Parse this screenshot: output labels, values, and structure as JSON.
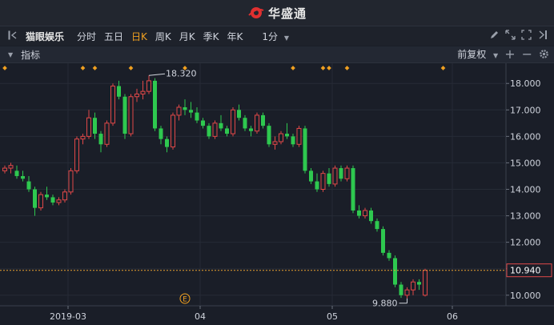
{
  "app": {
    "title": "华盛通"
  },
  "toolbar": {
    "stock_name": "猫眼娱乐",
    "tabs": [
      "分时",
      "五日",
      "日K",
      "周K",
      "月K",
      "季K",
      "年K"
    ],
    "active_tab": "日K",
    "interval": "1分"
  },
  "indicator_bar": {
    "label": "指标",
    "adjust": "前复权"
  },
  "colors": {
    "up": "#e04848",
    "down": "#2ec84f",
    "accent": "#f0a020",
    "bg": "#1a1e28"
  },
  "icons": [
    "logo-icon",
    "sidebar-toggle-icon",
    "dropdown-icon",
    "pencil-icon",
    "expand-icon",
    "fullscreen-icon",
    "collapse-icon",
    "plus-icon",
    "minus-icon",
    "gear-icon"
  ],
  "chart_data": {
    "type": "candlestick",
    "x_ticks": [
      {
        "label": "2019-03",
        "index": 10
      },
      {
        "label": "04",
        "index": 32
      },
      {
        "label": "05",
        "index": 54
      },
      {
        "label": "06",
        "index": 74
      }
    ],
    "y_ticks": [
      "18.000",
      "17.000",
      "16.000",
      "15.000",
      "14.000",
      "13.000",
      "12.000",
      "11.000",
      "10.000"
    ],
    "ylim": [
      9.6,
      18.4
    ],
    "annotations": {
      "high": "18.320",
      "low": "9.880",
      "last_price": "10.940",
      "event_marker": "E"
    },
    "candles": [
      [
        14.7,
        14.9,
        14.6,
        14.8
      ],
      [
        14.8,
        15.0,
        14.6,
        14.9
      ],
      [
        14.7,
        14.9,
        14.4,
        14.5
      ],
      [
        14.5,
        14.7,
        14.3,
        14.4
      ],
      [
        14.3,
        14.5,
        13.9,
        14.0
      ],
      [
        14.0,
        14.1,
        13.0,
        13.3
      ],
      [
        13.3,
        13.9,
        13.2,
        13.8
      ],
      [
        13.8,
        14.1,
        13.6,
        13.7
      ],
      [
        13.7,
        13.8,
        13.4,
        13.5
      ],
      [
        13.5,
        13.7,
        13.4,
        13.6
      ],
      [
        13.6,
        14.0,
        13.5,
        13.9
      ],
      [
        13.9,
        14.8,
        13.8,
        14.7
      ],
      [
        14.7,
        16.0,
        14.6,
        15.9
      ],
      [
        15.9,
        16.1,
        15.7,
        16.0
      ],
      [
        16.0,
        17.0,
        15.9,
        16.7
      ],
      [
        16.7,
        16.9,
        15.9,
        16.1
      ],
      [
        16.1,
        16.2,
        15.4,
        15.7
      ],
      [
        15.7,
        16.6,
        15.6,
        16.5
      ],
      [
        16.5,
        18.0,
        16.4,
        17.9
      ],
      [
        17.9,
        18.1,
        17.4,
        17.5
      ],
      [
        17.5,
        17.6,
        15.9,
        16.1
      ],
      [
        16.1,
        17.6,
        16.0,
        17.5
      ],
      [
        17.5,
        17.8,
        17.3,
        17.6
      ],
      [
        17.6,
        18.1,
        17.4,
        17.7
      ],
      [
        17.7,
        18.3,
        17.6,
        18.1
      ],
      [
        18.1,
        18.2,
        16.2,
        16.3
      ],
      [
        16.3,
        16.4,
        15.7,
        15.9
      ],
      [
        15.9,
        16.0,
        15.4,
        15.6
      ],
      [
        15.6,
        16.9,
        15.5,
        16.8
      ],
      [
        16.8,
        17.2,
        16.6,
        17.1
      ],
      [
        17.1,
        17.4,
        16.8,
        17.0
      ],
      [
        17.0,
        17.3,
        16.7,
        16.9
      ],
      [
        16.9,
        17.1,
        16.5,
        16.6
      ],
      [
        16.6,
        16.7,
        16.3,
        16.4
      ],
      [
        16.4,
        16.5,
        15.9,
        16.0
      ],
      [
        16.0,
        16.6,
        15.9,
        16.5
      ],
      [
        16.5,
        16.8,
        16.2,
        16.3
      ],
      [
        16.3,
        16.4,
        16.0,
        16.1
      ],
      [
        16.1,
        17.1,
        16.0,
        17.0
      ],
      [
        17.0,
        17.2,
        16.6,
        16.7
      ],
      [
        16.7,
        16.8,
        16.2,
        16.3
      ],
      [
        16.3,
        16.4,
        16.0,
        16.2
      ],
      [
        16.2,
        16.9,
        16.1,
        16.8
      ],
      [
        16.8,
        16.9,
        16.3,
        16.4
      ],
      [
        16.4,
        16.5,
        15.6,
        15.7
      ],
      [
        15.7,
        16.0,
        15.5,
        15.8
      ],
      [
        15.8,
        16.2,
        15.7,
        16.1
      ],
      [
        16.1,
        16.5,
        15.9,
        16.0
      ],
      [
        16.0,
        16.1,
        15.6,
        15.7
      ],
      [
        15.7,
        16.4,
        15.6,
        16.3
      ],
      [
        16.3,
        16.4,
        14.6,
        14.7
      ],
      [
        14.7,
        14.8,
        14.2,
        14.3
      ],
      [
        14.3,
        14.6,
        13.9,
        14.0
      ],
      [
        14.0,
        14.7,
        13.9,
        14.6
      ],
      [
        14.6,
        14.8,
        14.1,
        14.2
      ],
      [
        14.2,
        14.9,
        14.1,
        14.8
      ],
      [
        14.8,
        14.9,
        14.3,
        14.4
      ],
      [
        14.4,
        14.9,
        14.3,
        14.8
      ],
      [
        14.8,
        14.9,
        13.1,
        13.2
      ],
      [
        13.2,
        13.4,
        12.9,
        13.0
      ],
      [
        13.0,
        13.3,
        12.9,
        13.2
      ],
      [
        13.2,
        13.3,
        12.7,
        12.8
      ],
      [
        12.8,
        12.9,
        12.4,
        12.5
      ],
      [
        12.5,
        12.6,
        11.5,
        11.6
      ],
      [
        11.6,
        11.7,
        11.3,
        11.4
      ],
      [
        11.4,
        11.5,
        10.3,
        10.4
      ],
      [
        10.4,
        10.5,
        9.9,
        10.0
      ],
      [
        10.0,
        10.3,
        9.88,
        10.2
      ],
      [
        10.2,
        10.6,
        10.0,
        10.5
      ],
      [
        10.5,
        10.6,
        10.2,
        10.4
      ],
      [
        10.0,
        11.0,
        9.95,
        10.94
      ]
    ]
  }
}
